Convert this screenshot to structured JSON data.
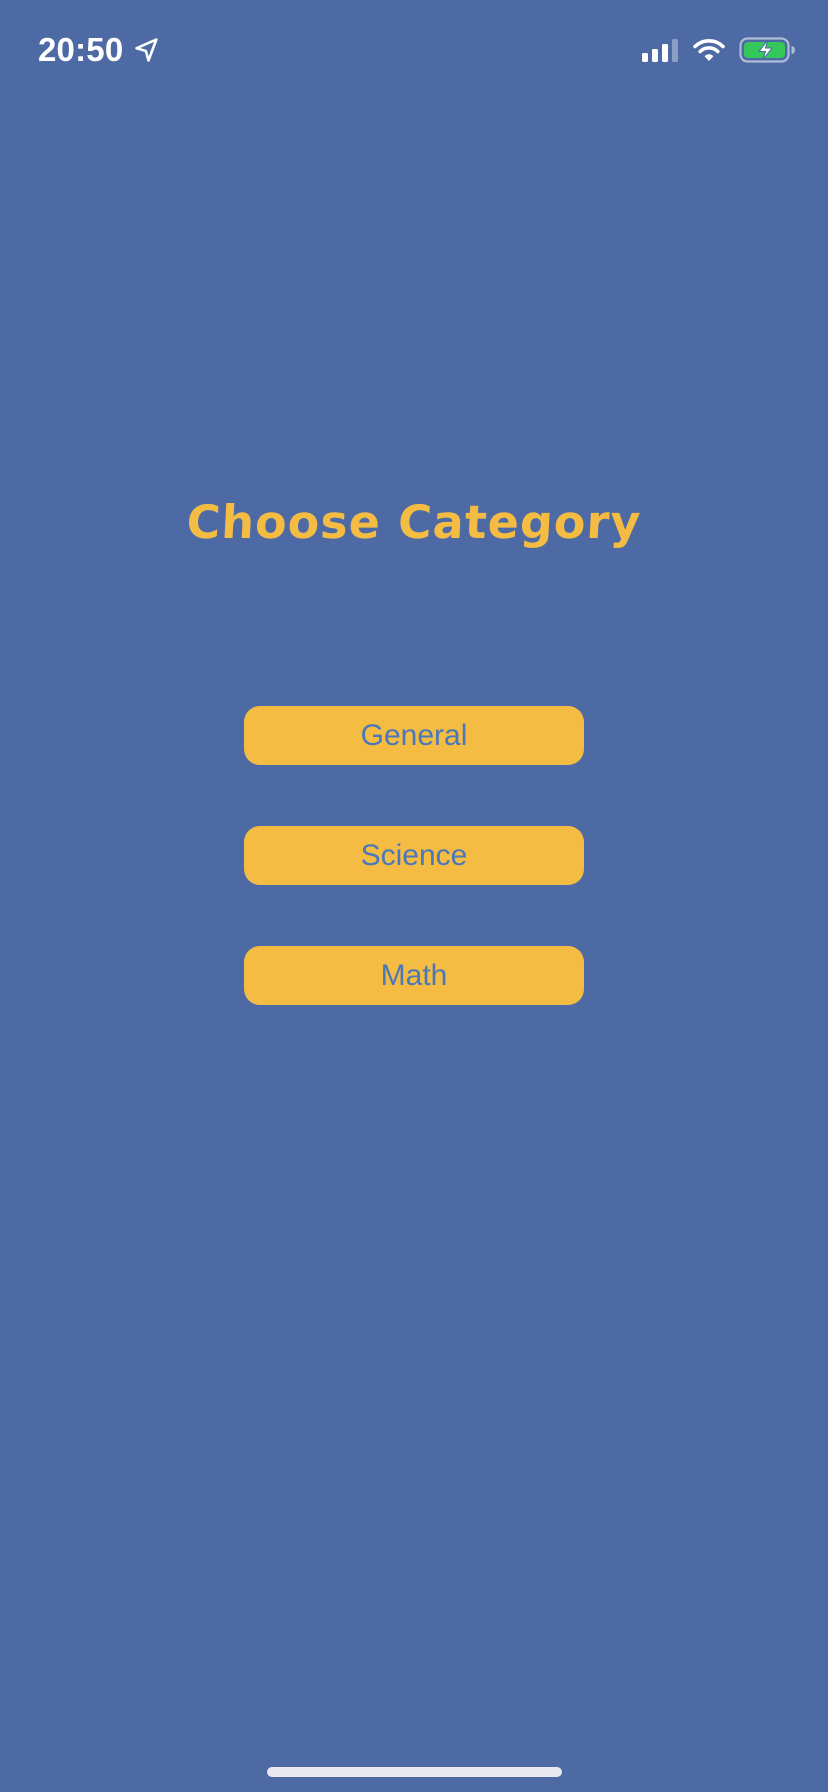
{
  "status_bar": {
    "time": "20:50",
    "location_icon": "location-arrow-icon",
    "signal_icon": "cellular-signal-icon",
    "wifi_icon": "wifi-icon",
    "battery_icon": "battery-charging-icon"
  },
  "screen": {
    "title": "Choose Category",
    "categories": [
      {
        "label": "General"
      },
      {
        "label": "Science"
      },
      {
        "label": "Math"
      }
    ]
  },
  "colors": {
    "background": "#4D6AA5",
    "accent": "#F4BC42",
    "button_text": "#4A78B9",
    "battery_fill": "#34C759"
  }
}
